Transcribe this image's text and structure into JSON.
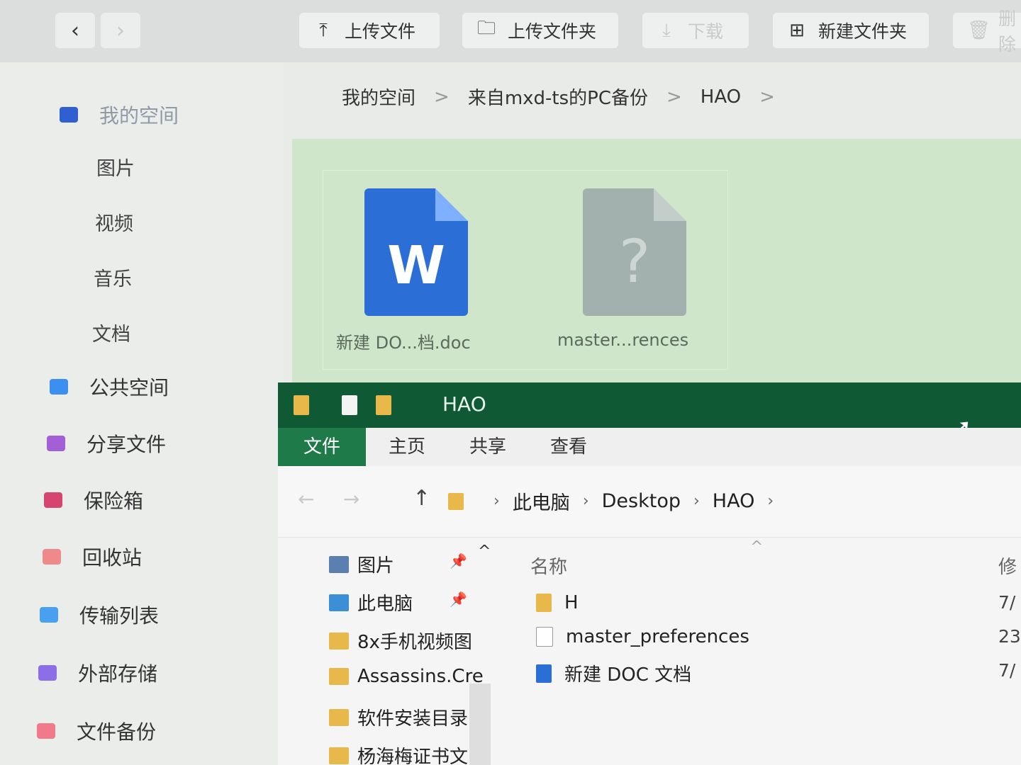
{
  "toolbar": {
    "back_glyph": "‹",
    "forward_glyph": "›",
    "upload_file": "上传文件",
    "upload_folder": "上传文件夹",
    "download": "下载",
    "new_folder": "新建文件夹",
    "more": "删除"
  },
  "sidebar": {
    "my_space": "我的空间",
    "sub_items": [
      "图片",
      "视频",
      "音乐",
      "文档"
    ],
    "items": [
      {
        "label": "公共空间",
        "color": "#3b8ff0"
      },
      {
        "label": "分享文件",
        "color": "#a35fd6"
      },
      {
        "label": "保险箱",
        "color": "#d6456f"
      },
      {
        "label": "回收站",
        "color": "#f08a8a"
      },
      {
        "label": "传输列表",
        "color": "#4aa0f0"
      },
      {
        "label": "外部存储",
        "color": "#8c6ee6"
      },
      {
        "label": "文件备份",
        "color": "#f07a8a"
      }
    ]
  },
  "breadcrumb": {
    "items": [
      "我的空间",
      "来自mxd-ts的PC备份",
      "HAO"
    ],
    "sep": ">"
  },
  "files": [
    {
      "label": "新建 DO...档.doc",
      "icon_letter": "W",
      "kind": "word"
    },
    {
      "label": "master...rences",
      "icon_letter": "?",
      "kind": "unknown"
    }
  ],
  "explorer": {
    "title": "HAO",
    "ribbon_tabs": [
      "文件",
      "主页",
      "共享",
      "查看"
    ],
    "back": "←",
    "forward": "→",
    "up": "↑",
    "path": [
      "此电脑",
      "Desktop",
      "HAO"
    ],
    "path_sep": "›",
    "nav_items": [
      {
        "label": "图片",
        "pinned": true,
        "color": "#5b7fb0"
      },
      {
        "label": "此电脑",
        "pinned": true,
        "color": "#3a8fd6"
      },
      {
        "label": "8x手机视频图",
        "pinned": false,
        "color": "#e8b84a"
      },
      {
        "label": "Assassins.Cre",
        "pinned": false,
        "color": "#e8b84a"
      },
      {
        "label": "软件安装目录",
        "pinned": false,
        "color": "#e8b84a"
      },
      {
        "label": "杨海梅证书文",
        "pinned": false,
        "color": "#e8b84a"
      }
    ],
    "pin_glyph": "📌",
    "caret_glyph": "^",
    "column_name": "名称",
    "column_modified": "修",
    "sort_glyph": "^",
    "rows": [
      {
        "name": "H",
        "date": "7/",
        "color": "#e8b84a"
      },
      {
        "name": "master_preferences",
        "date": "23",
        "color": "#ffffff"
      },
      {
        "name": "新建 DOC 文档",
        "date": "7/",
        "color": "#2b6fd6"
      }
    ]
  }
}
